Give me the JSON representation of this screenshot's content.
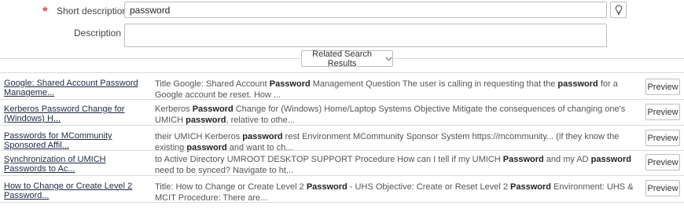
{
  "form": {
    "short_description": {
      "label": "Short description",
      "value": "password"
    },
    "description": {
      "label": "Description",
      "value": ""
    }
  },
  "related": {
    "toggle_label": "Related Search Results",
    "results": [
      {
        "title": "Google: Shared Account Password Manageme...",
        "snippet": [
          {
            "t": "Title Google: Shared Account "
          },
          {
            "t": "Password",
            "b": true
          },
          {
            "t": " Management Question  The user is calling in requesting that the "
          },
          {
            "t": "password",
            "b": true
          },
          {
            "t": " for a Google account be reset. How ..."
          }
        ],
        "button": "Preview"
      },
      {
        "title": "Kerberos Password Change for (Windows) H...",
        "snippet": [
          {
            "t": "Kerberos "
          },
          {
            "t": "Password",
            "b": true
          },
          {
            "t": " Change for (Windows) Home/Laptop Systems Objective   Mitigate the consequences of changing one's UMICH "
          },
          {
            "t": "password",
            "b": true
          },
          {
            "t": ", relative to othe..."
          }
        ],
        "button": "Preview"
      },
      {
        "title": "Passwords for MCommunity Sponsored Affil...",
        "snippet": [
          {
            "t": "their UMICH Kerberos "
          },
          {
            "t": "password",
            "b": true
          },
          {
            "t": " rest Environment MCommunity Sponsor System https://mcommunity... (if they know the existing "
          },
          {
            "t": "password",
            "b": true
          },
          {
            "t": " and want to ch..."
          }
        ],
        "button": "Preview"
      },
      {
        "title": "Synchronization of UMICH Passwords to Ac...",
        "snippet": [
          {
            "t": "to Active Directory UMROOT    DESKTOP SUPPORT    Procedure How can I tell if my UMICH "
          },
          {
            "t": "Password",
            "b": true
          },
          {
            "t": " and my AD "
          },
          {
            "t": "password",
            "b": true
          },
          {
            "t": " need to be synced? Navigate to ht..."
          }
        ],
        "button": "Preview"
      },
      {
        "title": "How to Change or Create Level 2 Password...",
        "snippet": [
          {
            "t": "Title: How to Change or Create Level 2 "
          },
          {
            "t": "Password",
            "b": true
          },
          {
            "t": " - UHS Objective: Create or Reset Level 2 "
          },
          {
            "t": "Password",
            "b": true
          },
          {
            "t": "   Environment: UHS & MCIT   Procedure: There are..."
          }
        ],
        "button": "Preview"
      }
    ]
  },
  "colors": {
    "required": "#d9534f",
    "border": "#b9bec4",
    "divider": "#d8dadd"
  },
  "icons": {
    "required": "asterisk",
    "suggest": "lightbulb-icon",
    "toggle": "chevron-down-icon"
  }
}
